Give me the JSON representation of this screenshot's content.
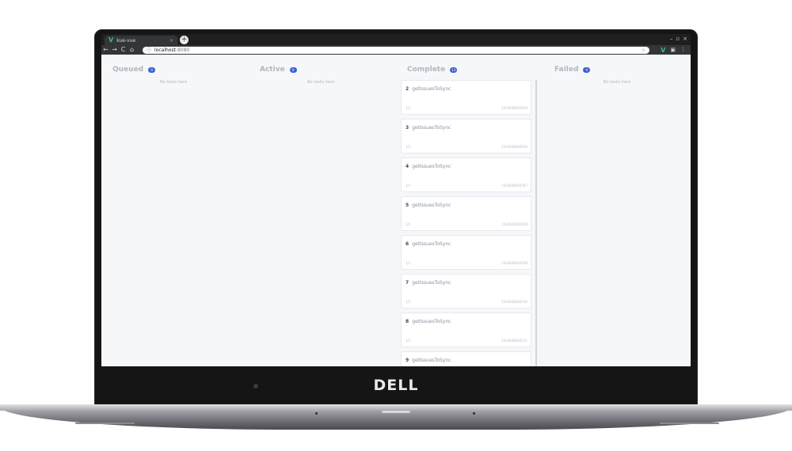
{
  "browser": {
    "tab_title": "kue-vue",
    "tab_favicon": "V",
    "tab_close": "×",
    "new_tab": "+",
    "url_host": "localhost",
    "url_port": ":8080",
    "nav": {
      "back": "←",
      "forward": "→",
      "reload": "C",
      "home": "⌂"
    },
    "window_controls": [
      "–",
      "▫",
      "×"
    ],
    "extension_vue": "V"
  },
  "brand": "DELL",
  "columns": {
    "queued": {
      "title": "Queued",
      "count": "0",
      "empty": "No tasks here"
    },
    "active": {
      "title": "Active",
      "count": "0",
      "empty": "No tasks here"
    },
    "complete": {
      "title": "Complete",
      "count": "13"
    },
    "failed": {
      "title": "Failed",
      "count": "0",
      "empty": "No tasks here"
    }
  },
  "complete_tasks": [
    {
      "id": "2",
      "name": "getIssuesToSync",
      "progress": "1/1",
      "time": "1534836640504"
    },
    {
      "id": "3",
      "name": "getIssuesToSync",
      "progress": "1/1",
      "time": "1534836640506"
    },
    {
      "id": "4",
      "name": "getIssuesToSync",
      "progress": "1/1",
      "time": "1534836640507"
    },
    {
      "id": "5",
      "name": "getIssuesToSync",
      "progress": "1/1",
      "time": "1534836640508"
    },
    {
      "id": "6",
      "name": "getIssuesToSync",
      "progress": "1/1",
      "time": "1534836640509"
    },
    {
      "id": "7",
      "name": "getIssuesToSync",
      "progress": "1/1",
      "time": "1534836640510"
    },
    {
      "id": "8",
      "name": "getIssuesToSync",
      "progress": "1/1",
      "time": "1534836640511"
    },
    {
      "id": "9",
      "name": "getIssuesToSync",
      "progress": "",
      "time": ""
    }
  ]
}
